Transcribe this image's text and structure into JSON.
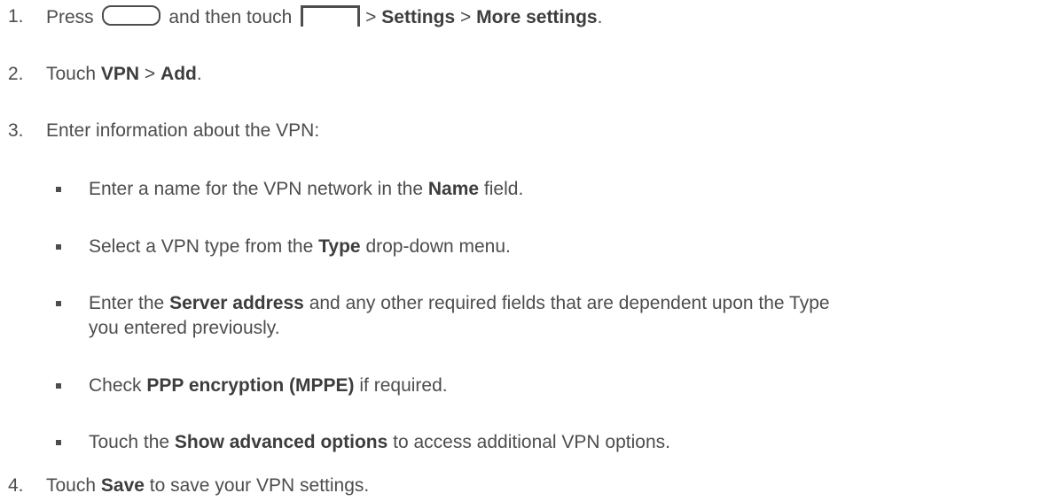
{
  "steps": [
    {
      "num": "1.",
      "press": "Press",
      "then": "and then touch",
      "sep1": ">",
      "settings": "Settings",
      "sep2": ">",
      "more": "More settings",
      "end": "."
    },
    {
      "num": "2.",
      "touch": "Touch",
      "vpn": "VPN",
      "sep": ">",
      "add": "Add",
      "end": "."
    },
    {
      "num": "3.",
      "text": "Enter information about the VPN:"
    },
    {
      "num": "4.",
      "touch": "Touch",
      "save": "Save",
      "rest": "to save your VPN settings."
    }
  ],
  "bullets": [
    {
      "pre": "Enter a name for the VPN network in the",
      "bold": "Name",
      "post": "field."
    },
    {
      "pre": "Select a VPN type from the",
      "bold": "Type",
      "post": "drop-down menu."
    },
    {
      "pre": "Enter the",
      "bold": "Server address",
      "post": "and any other required fields that are dependent upon the Type",
      "line2": "you entered previously."
    },
    {
      "pre": "Check",
      "bold": "PPP encryption (MPPE)",
      "post": "if required."
    },
    {
      "pre": "Touch the",
      "bold": "Show advanced options",
      "post": "to access additional VPN options."
    }
  ],
  "icons": [
    "home-button-icon",
    "menu-icon"
  ]
}
